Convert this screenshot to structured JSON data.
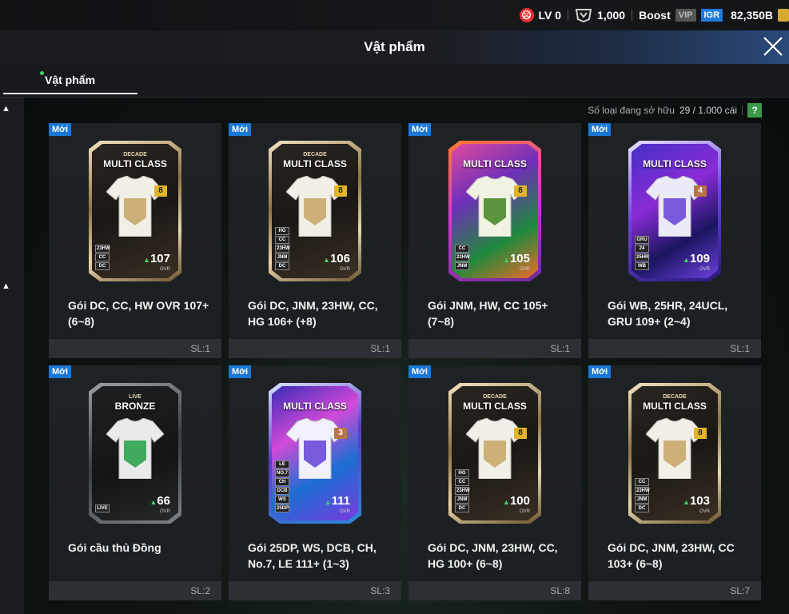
{
  "status": {
    "level": "LV 0",
    "points": "1,000",
    "boost": "Boost",
    "vip": "VIP",
    "igr": "IGR",
    "balance": "82,350B",
    "colors": {
      "level_face": "#e53030",
      "igr": "#1e7bdc",
      "vip": "#555555",
      "coin": "#d6a830"
    }
  },
  "header": {
    "title": "Vật phẩm",
    "close_icon": "close-icon"
  },
  "tabs": [
    {
      "label": "Vật phẩm",
      "active": true
    }
  ],
  "inventory": {
    "owned_label": "Số loại đang sở hữu",
    "owned_count": "29 / 1.000 cái",
    "help": "?"
  },
  "items": [
    {
      "badge": "Mới",
      "sub": "DECADE",
      "title": "MULTI CLASS",
      "grade": "8",
      "ovr": "107",
      "ovr_label": "OVR",
      "tags": [
        "23HW",
        "CC",
        "DC"
      ],
      "name": "Gói DC, CC, HW OVR 107+ (6~8)",
      "qty": "SL:1"
    },
    {
      "badge": "Mới",
      "sub": "DECADE",
      "title": "MULTI CLASS",
      "grade": "8",
      "ovr": "106",
      "ovr_label": "OVR",
      "tags": [
        "HG",
        "CC",
        "23HW",
        "JNM",
        "DC"
      ],
      "name": "Gói DC, JNM, 23HW, CC, HG 106+ (+8)",
      "qty": "SL:1"
    },
    {
      "badge": "Mới",
      "sub": "",
      "title": "MULTI CLASS",
      "grade": "8",
      "ovr": "105",
      "ovr_label": "OVR",
      "tags": [
        "CC",
        "23HW",
        "JNM"
      ],
      "name": "Gói JNM, HW, CC 105+ (7~8)",
      "qty": "SL:1"
    },
    {
      "badge": "Mới",
      "sub": "",
      "title": "MULTI CLASS",
      "grade": "4",
      "ovr": "109",
      "ovr_label": "OVR",
      "tags": [
        "GRU",
        "24",
        "25HR",
        "WB"
      ],
      "name": "Gói WB, 25HR, 24UCL, GRU 109+ (2~4)",
      "qty": "SL:1"
    },
    {
      "badge": "Mới",
      "sub": "LIVE",
      "title": "BRONZE",
      "grade": "",
      "ovr": "66",
      "ovr_label": "OVR",
      "tags": [
        "LIVE"
      ],
      "name": "Gói cầu thủ Đồng",
      "qty": "SL:2"
    },
    {
      "badge": "Mới",
      "sub": "",
      "title": "MULTI CLASS",
      "grade": "3",
      "ovr": "111",
      "ovr_label": "OVR",
      "tags": [
        "LE",
        "NO.7",
        "CH",
        "DCB",
        "WS",
        "25DP"
      ],
      "name": "Gói 25DP, WS, DCB, CH, No.7, LE 111+ (1~3)",
      "qty": "SL:3"
    },
    {
      "badge": "Mới",
      "sub": "DECADE",
      "title": "MULTI CLASS",
      "grade": "8",
      "ovr": "100",
      "ovr_label": "OVR",
      "tags": [
        "HG",
        "CC",
        "23HW",
        "JNM",
        "DC"
      ],
      "name": "Gói DC, JNM, 23HW, CC, HG 100+ (6~8)",
      "qty": "SL:8"
    },
    {
      "badge": "Mới",
      "sub": "DECADE",
      "title": "MULTI CLASS",
      "grade": "8",
      "ovr": "103",
      "ovr_label": "OVR",
      "tags": [
        "CC",
        "23HW",
        "JNM",
        "DC"
      ],
      "name": "Gói DC, JNM, 23HW, CC 103+ (6~8)",
      "qty": "SL:7"
    }
  ]
}
